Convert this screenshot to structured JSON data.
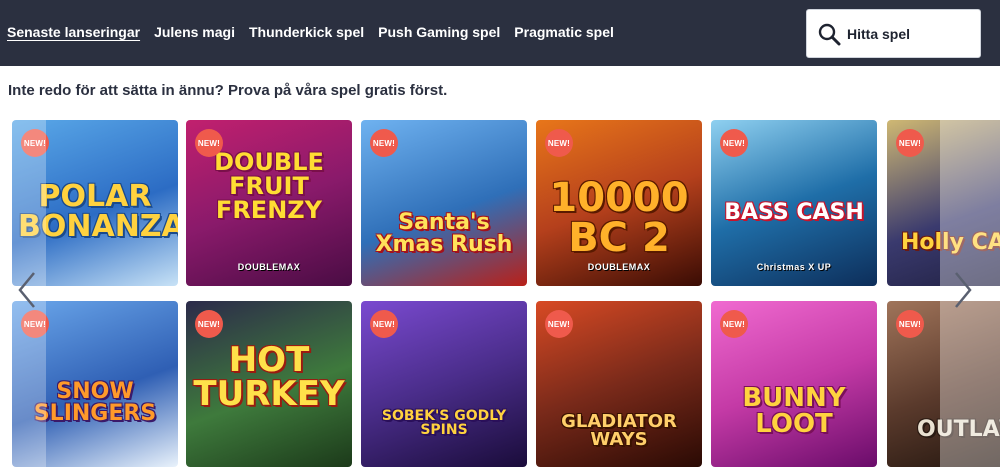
{
  "nav": {
    "items": [
      {
        "label": "Senaste lanseringar",
        "active": true
      },
      {
        "label": "Julens magi",
        "active": false
      },
      {
        "label": "Thunderkick spel",
        "active": false
      },
      {
        "label": "Push Gaming spel",
        "active": false
      },
      {
        "label": "Pragmatic spel",
        "active": false
      }
    ]
  },
  "search": {
    "label": "Hitta spel",
    "icon": "search-icon"
  },
  "tagline": "Inte redo för att sätta in ännu? Prova på våra spel gratis först.",
  "badge_text": "NEW!",
  "games": [
    {
      "title": "POLAR BONANZA",
      "sub": "",
      "bg": "#4b8fd6"
    },
    {
      "title": "DOUBLE FRUIT FRENZY",
      "sub": "DOUBLEMAX",
      "bg": "#8a1a6b"
    },
    {
      "title": "Santa's Xmas Rush",
      "sub": "",
      "bg": "#2f6fb8"
    },
    {
      "title": "10000 BC 2",
      "sub": "DOUBLEMAX",
      "bg": "#b5401c"
    },
    {
      "title": "BASS CASH",
      "sub": "Christmas X UP",
      "bg": "#1f6ea8"
    },
    {
      "title": "Holly CASH",
      "sub": "",
      "bg": "#3a3a6e"
    },
    {
      "title": "SNOW SLINGERS",
      "sub": "",
      "bg": "#2f5fb4"
    },
    {
      "title": "HOT TURKEY",
      "sub": "",
      "bg": "#3e7a3c"
    },
    {
      "title": "SOBEK'S GODLY SPINS",
      "sub": "",
      "bg": "#4a2d8a"
    },
    {
      "title": "GLADIATOR WAYS",
      "sub": "",
      "bg": "#7a2a1a"
    },
    {
      "title": "BUNNY LOOT",
      "sub": "",
      "bg": "#c43aa6"
    },
    {
      "title": "OUTLAW",
      "sub": "",
      "bg": "#5a3a2c"
    }
  ],
  "arrows": {
    "prev": "chevron-left-icon",
    "next": "chevron-right-icon"
  }
}
